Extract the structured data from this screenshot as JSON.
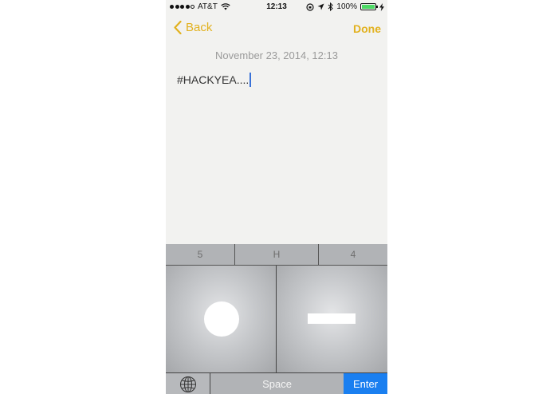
{
  "status_bar": {
    "carrier": "AT&T",
    "time": "12:13",
    "battery": "100%"
  },
  "nav": {
    "back_label": "Back",
    "done_label": "Done"
  },
  "note": {
    "date": "November 23, 2014, 12:13",
    "text": "#HACKYEA...."
  },
  "keyboard": {
    "suggestions": [
      "5",
      "H",
      "4"
    ],
    "space_label": "Space",
    "enter_label": "Enter"
  },
  "colors": {
    "accent": "#e2b11e",
    "enter_key": "#1a7ff0",
    "cursor": "#3a72d8",
    "battery": "#4cd964"
  },
  "icons": {
    "back": "chevron-left-icon",
    "globe": "globe-icon",
    "wifi": "wifi-icon",
    "bluetooth": "bluetooth-icon",
    "location": "location-arrow-icon",
    "rotation_lock": "rotation-lock-icon"
  }
}
